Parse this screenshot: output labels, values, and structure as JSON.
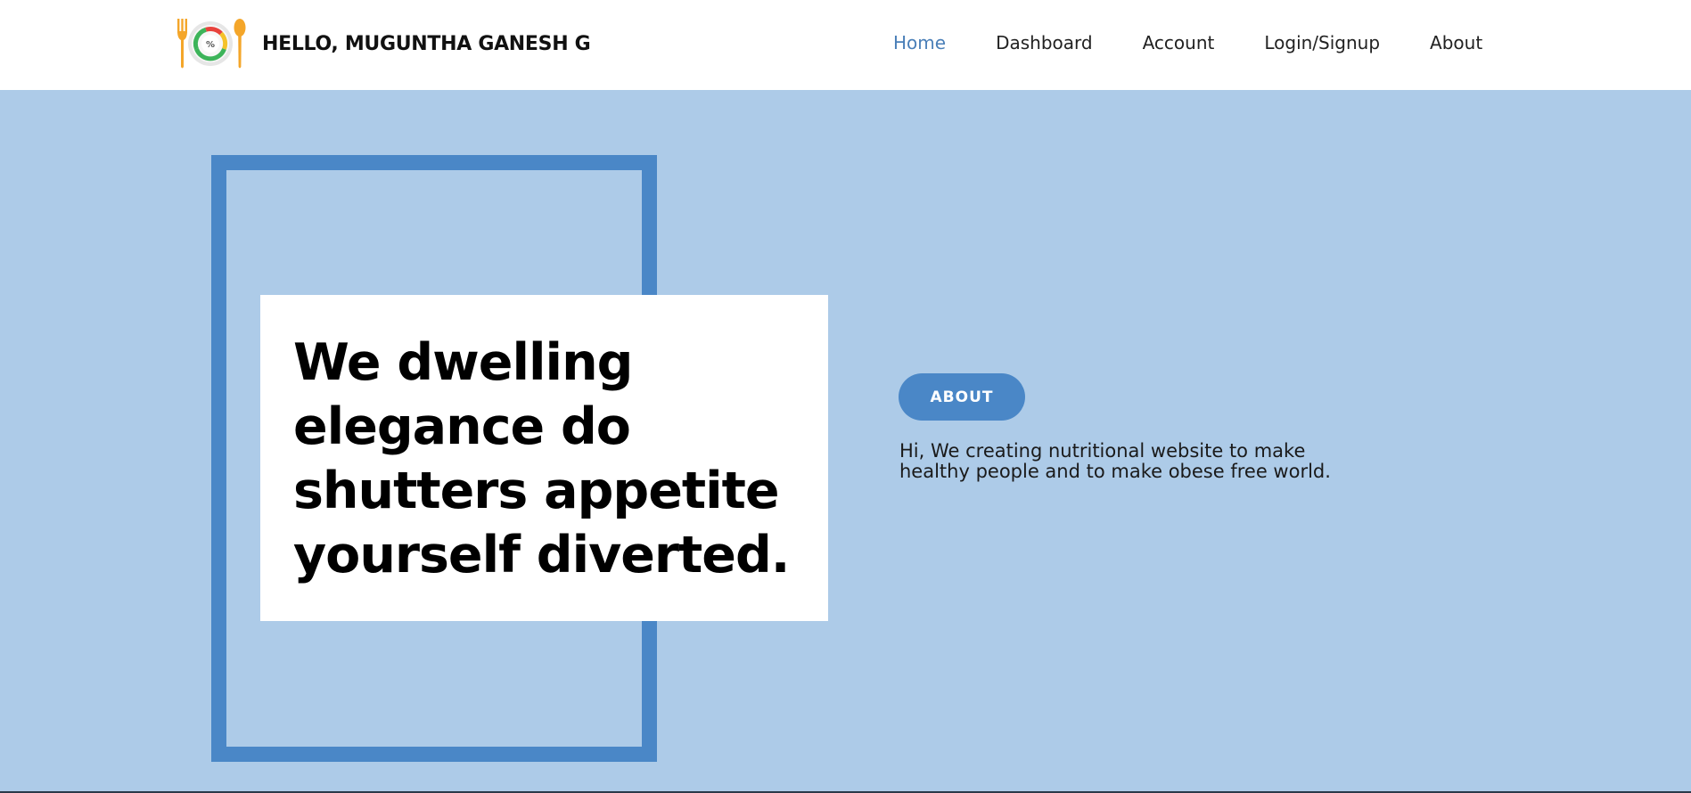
{
  "header": {
    "brand_text": "HELLO, MUGUNTHA GANESH G",
    "logo_icon": "plate-fork-spoon-logo",
    "nav": [
      {
        "label": "Home",
        "active": true
      },
      {
        "label": "Dashboard",
        "active": false
      },
      {
        "label": "Account",
        "active": false
      },
      {
        "label": "Login/Signup",
        "active": false
      },
      {
        "label": "About",
        "active": false
      }
    ]
  },
  "hero": {
    "headline": "We dwelling elegance do shutters appetite yourself diverted.",
    "about_button_label": "ABOUT",
    "about_text": "Hi, We creating nutritional website to make healthy people and to make obese free world."
  },
  "colors": {
    "hero_background": "#adcbe8",
    "accent_blue": "#4a87c7",
    "nav_active": "#4a7fb8",
    "logo_orange": "#f4a62a"
  }
}
